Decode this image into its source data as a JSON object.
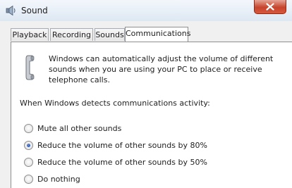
{
  "window": {
    "title": "Sound",
    "close_icon": "close-icon",
    "title_icon": "speaker-icon"
  },
  "tabs": [
    {
      "label": "Playback",
      "active": false
    },
    {
      "label": "Recording",
      "active": false
    },
    {
      "label": "Sounds",
      "active": false
    },
    {
      "label": "Communications",
      "active": true
    }
  ],
  "communications": {
    "icon": "telephone-icon",
    "description": "Windows can automatically adjust the volume of different sounds when you are using your PC to place or receive telephone calls.",
    "detect_label": "When Windows detects communications activity:",
    "options": [
      {
        "label": "Mute all other sounds",
        "checked": false
      },
      {
        "label": "Reduce the volume of other sounds by 80%",
        "checked": true
      },
      {
        "label": "Reduce the volume of other sounds by 50%",
        "checked": false
      },
      {
        "label": "Do nothing",
        "checked": false
      }
    ]
  },
  "colors": {
    "titlebar": "#dde8f3",
    "close_button": "#c7442c",
    "radio_dot": "#1b3f93"
  }
}
